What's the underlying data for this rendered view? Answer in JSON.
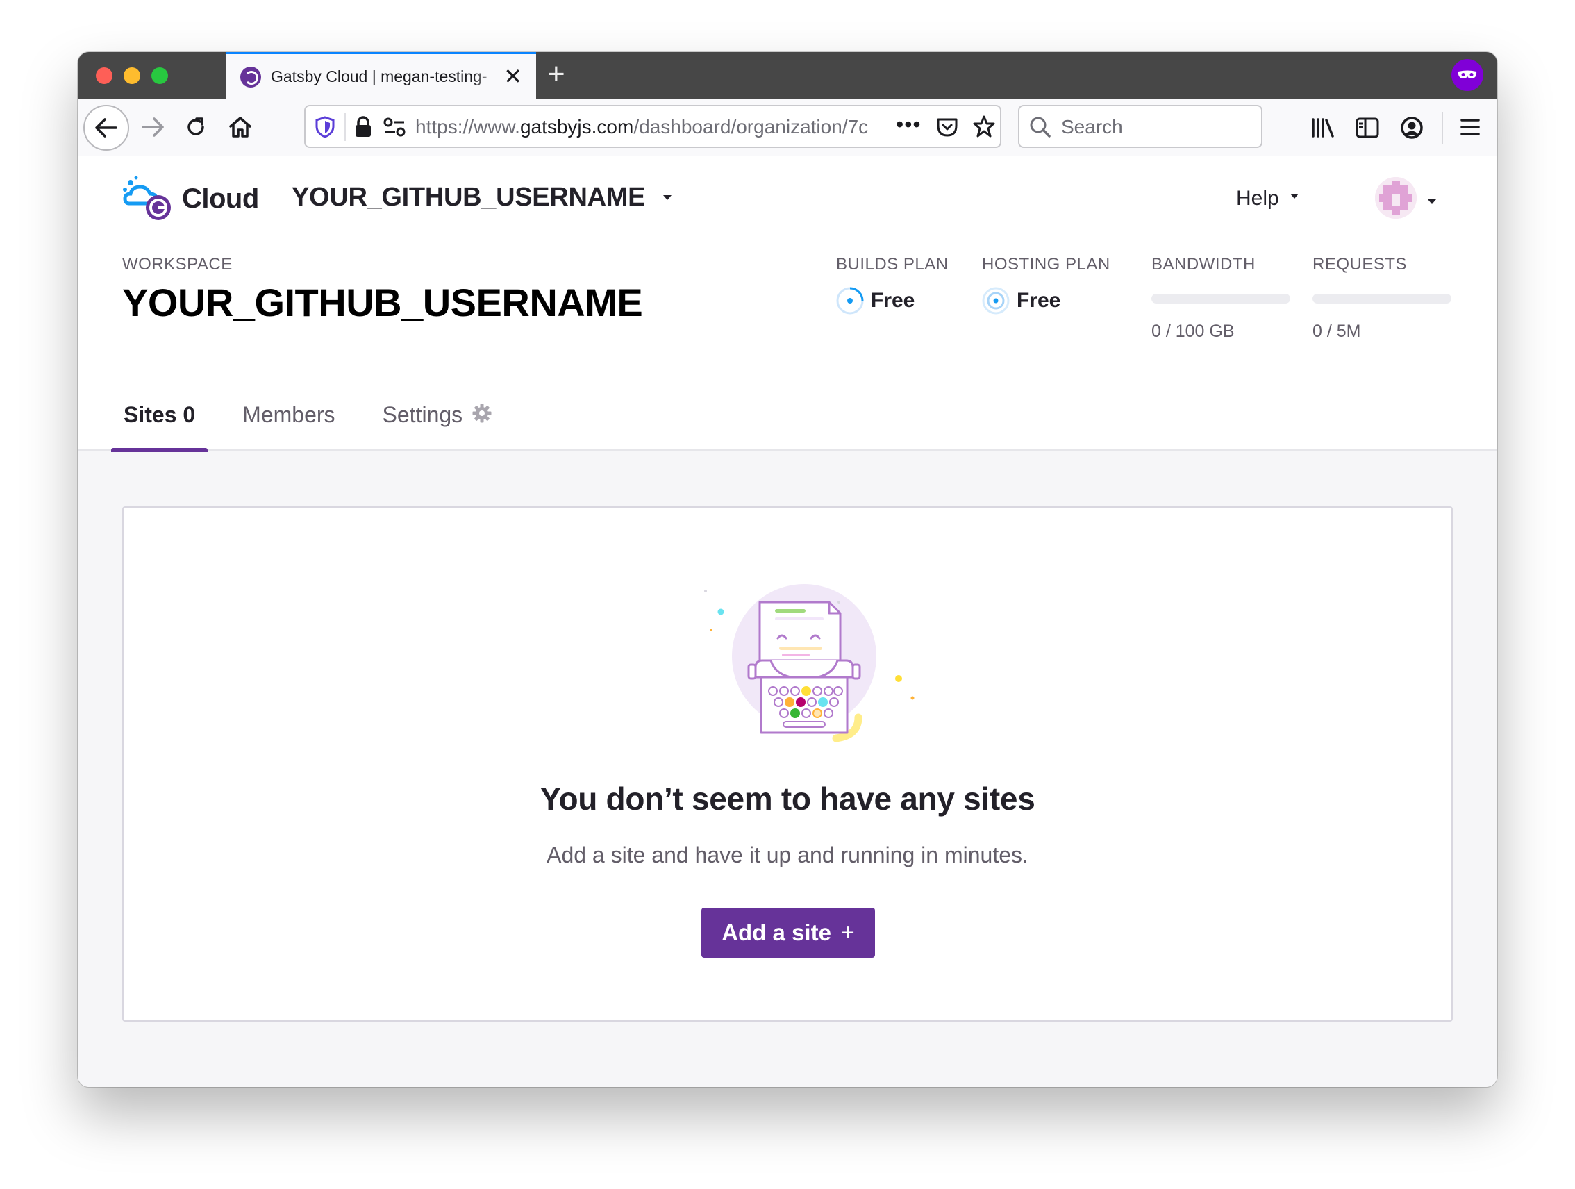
{
  "browser": {
    "tab_title": "Gatsby Cloud | megan-testing-",
    "url_prefix": "https://www.",
    "url_domain": "gatsbyjs.com",
    "url_path": "/dashboard/organization/7c",
    "search_placeholder": "Search",
    "accent_color": "#0a84ff",
    "private_badge_color": "#8000d7"
  },
  "header": {
    "logo_text": "Cloud",
    "org_name": "YOUR_GITHUB_USERNAME",
    "help_label": "Help"
  },
  "workspace": {
    "label": "WORKSPACE",
    "name": "YOUR_GITHUB_USERNAME"
  },
  "stats": {
    "builds_plan": {
      "label": "BUILDS PLAN",
      "value": "Free"
    },
    "hosting_plan": {
      "label": "HOSTING PLAN",
      "value": "Free"
    },
    "bandwidth": {
      "label": "BANDWIDTH",
      "value": "0 / 100 GB",
      "fraction": 0
    },
    "requests": {
      "label": "REQUESTS",
      "value": "0 / 5M",
      "fraction": 0
    }
  },
  "tabs": [
    {
      "label": "Sites 0",
      "active": true
    },
    {
      "label": "Members",
      "active": false
    },
    {
      "label": "Settings",
      "active": false,
      "icon": "gear-icon"
    }
  ],
  "empty_state": {
    "title": "You don’t seem to have any sites",
    "subtitle": "Add a site and have it up and running in minutes.",
    "button_label": "Add a site",
    "button_icon": "+"
  },
  "colors": {
    "brand_purple": "#663399",
    "text_primary": "#232129",
    "text_secondary": "#635e69"
  }
}
